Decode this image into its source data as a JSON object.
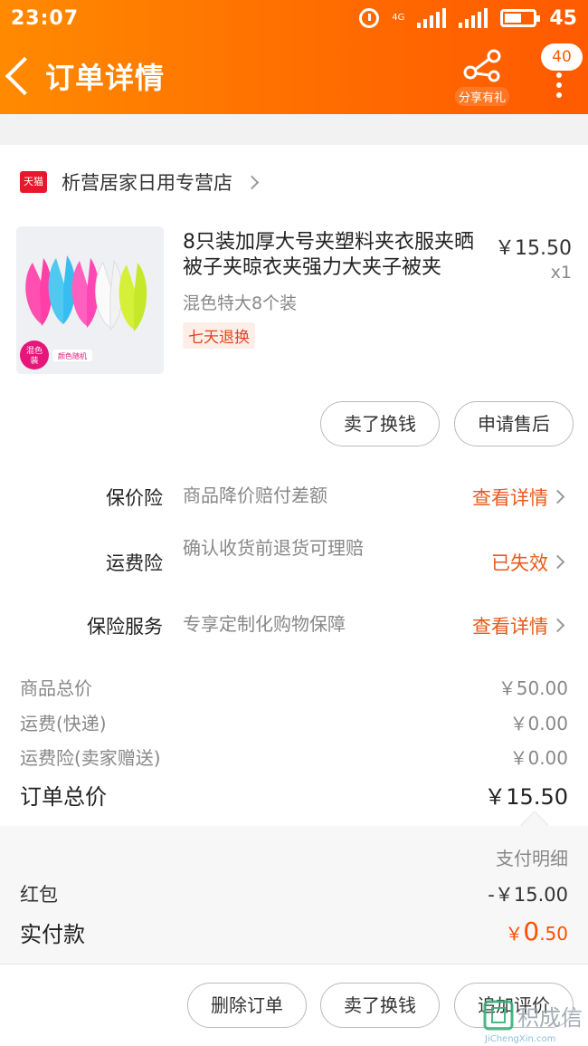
{
  "status": {
    "time": "23:07",
    "network": "4G",
    "battery": "45"
  },
  "nav": {
    "title": "订单详情",
    "share_label": "分享有礼",
    "badge": "40"
  },
  "shop": {
    "badge": "天猫",
    "name": "析营居家日用专营店"
  },
  "product": {
    "title": "8只装加厚大号夹塑料夹衣服夹晒被子夹晾衣夹强力大夹子被夹",
    "price": "￥15.50",
    "qty": "x1",
    "spec": "混色特大8个装",
    "return_tag": "七天退换",
    "image_badge_line1": "混色",
    "image_badge_line2": "装",
    "image_caption": "颜色随机"
  },
  "item_actions": {
    "sell": "卖了换钱",
    "after_sale": "申请售后"
  },
  "insurance": [
    {
      "name": "保价险",
      "desc": "商品降价赔付差额",
      "action": "查看详情"
    },
    {
      "name": "运费险",
      "desc": "确认收货前退货可理赔",
      "action": "已失效"
    },
    {
      "name": "保险服务",
      "desc": "专享定制化购物保障",
      "action": "查看详情"
    }
  ],
  "totals": [
    {
      "label": "商品总价",
      "value": "￥50.00"
    },
    {
      "label": "运费(快递)",
      "value": "￥0.00"
    },
    {
      "label": "运费险(卖家赠送)",
      "value": "￥0.00"
    }
  ],
  "order_total": {
    "label": "订单总价",
    "value": "￥15.50"
  },
  "payment": {
    "detail_label": "支付明细",
    "redpacket_label": "红包",
    "redpacket_value": "-￥15.00",
    "paid_label": "实付款",
    "paid_currency": "￥",
    "paid_int": "0",
    "paid_dec": ".50"
  },
  "footer": {
    "delete": "删除订单",
    "sell": "卖了换钱",
    "review": "追加评价"
  },
  "watermark": {
    "brand": "积成信",
    "url": "JiChengXin.com"
  },
  "colors": {
    "header_start": "#ff8a00",
    "header_end": "#ff5a00",
    "accent": "#e65a1e",
    "price_red": "#ff5000"
  }
}
